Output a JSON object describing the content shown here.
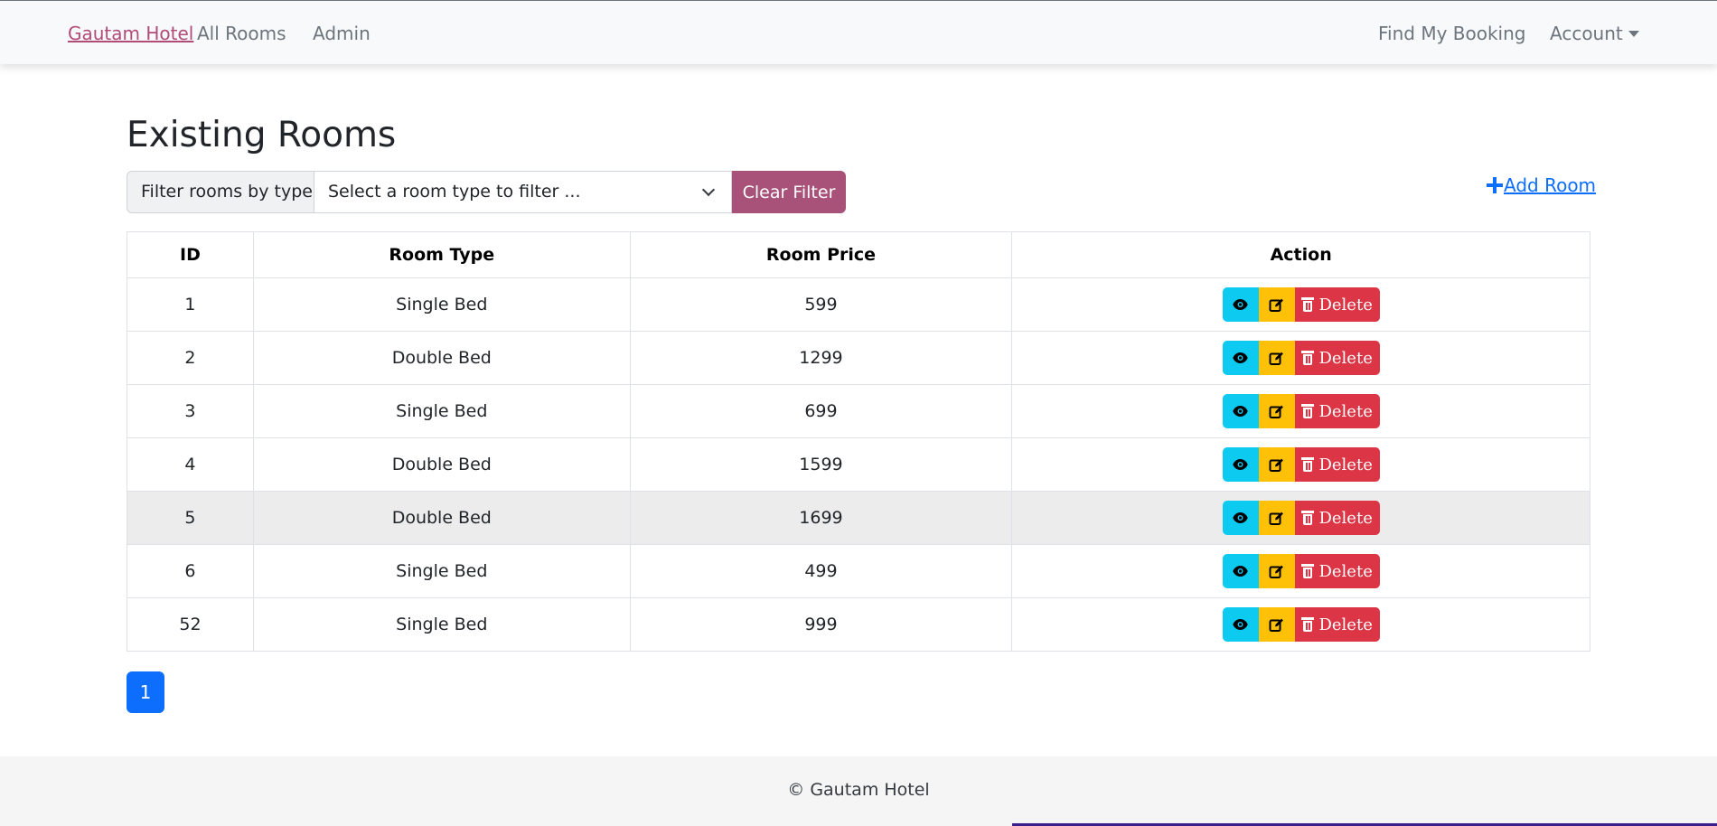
{
  "navbar": {
    "brand": "Gautam Hotel",
    "links": [
      "All Rooms",
      "Admin"
    ],
    "find_booking": "Find My Booking",
    "account": "Account"
  },
  "page": {
    "title": "Existing Rooms"
  },
  "filter": {
    "label": "Filter rooms by type",
    "select_placeholder": "Select a room type to filter ...",
    "clear_label": "Clear Filter"
  },
  "add_room_label": "Add Room",
  "table": {
    "headers": [
      "ID",
      "Room Type",
      "Room Price",
      "Action"
    ],
    "rows": [
      {
        "id": "1",
        "type": "Single Bed",
        "price": "599"
      },
      {
        "id": "2",
        "type": "Double Bed",
        "price": "1299"
      },
      {
        "id": "3",
        "type": "Single Bed",
        "price": "699"
      },
      {
        "id": "4",
        "type": "Double Bed",
        "price": "1599"
      },
      {
        "id": "5",
        "type": "Double Bed",
        "price": "1699"
      },
      {
        "id": "6",
        "type": "Single Bed",
        "price": "499"
      },
      {
        "id": "52",
        "type": "Single Bed",
        "price": "999"
      }
    ],
    "delete_label": "Delete",
    "highlighted_row_index": 4
  },
  "pagination": {
    "current_page": "1"
  },
  "footer": {
    "text": "© Gautam Hotel"
  },
  "colors": {
    "brand": "#b14b7a",
    "clear_button": "#a8527a",
    "view_button": "#0dcaf0",
    "edit_button": "#ffc107",
    "delete_button": "#dc3545",
    "primary": "#0d6efd"
  },
  "icons": {
    "view": "eye-icon",
    "edit": "edit-icon",
    "delete": "trash-icon",
    "add": "plus-icon",
    "dropdown": "chevron-down-icon",
    "account": "caret-down-icon"
  }
}
